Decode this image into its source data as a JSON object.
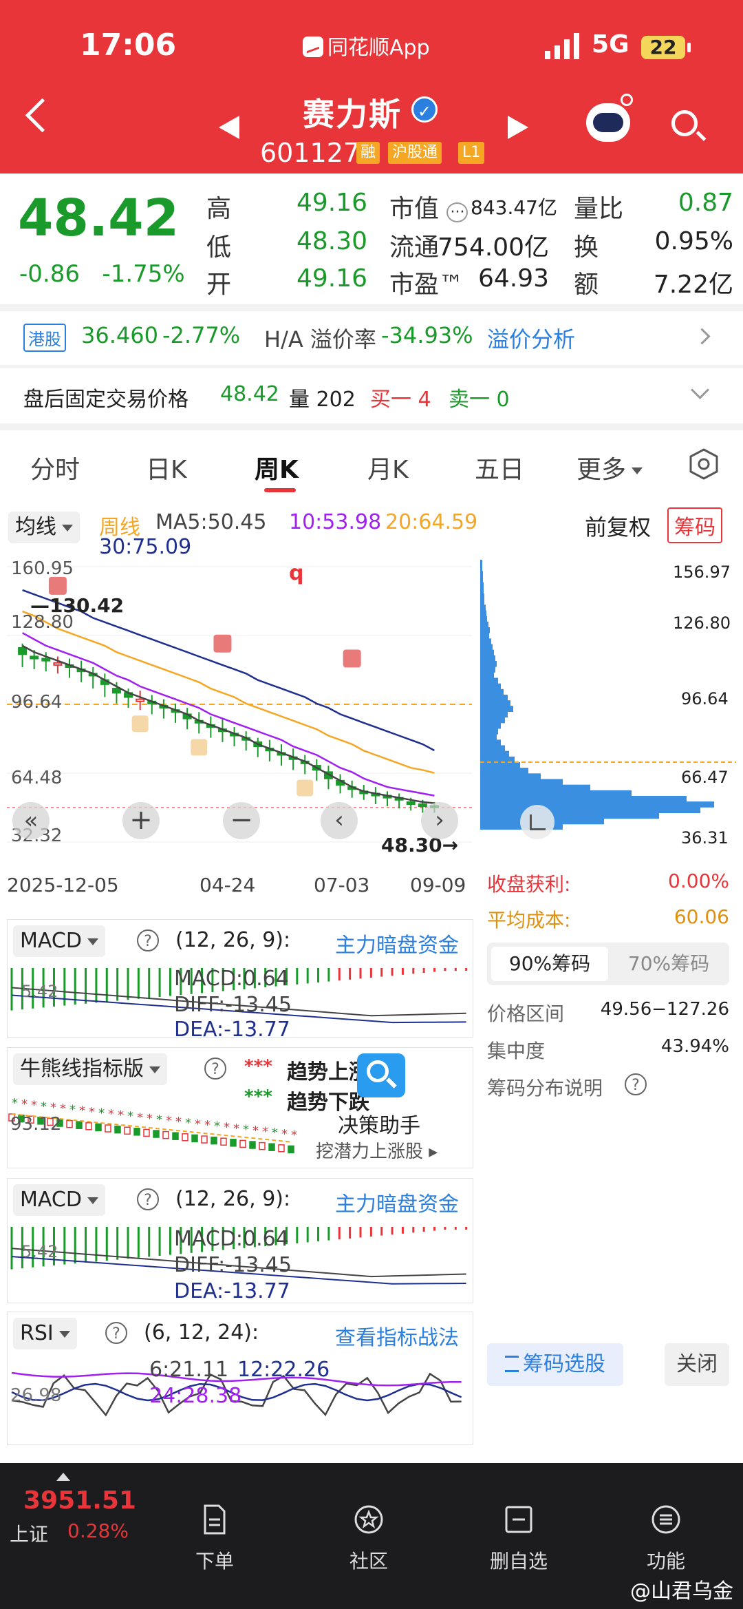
{
  "status": {
    "time": "17:06",
    "app": "同花顺App",
    "network": "5G",
    "battery": "22"
  },
  "header": {
    "name": "赛力斯",
    "code": "601127",
    "tags": [
      "融",
      "沪股通",
      "L1"
    ]
  },
  "quote": {
    "price": "48.42",
    "change": "-0.86",
    "change_pct": "-1.75%",
    "rows": [
      {
        "l1": "高",
        "v1": "49.16",
        "l2": "市值",
        "v2": "843.47亿",
        "l3": "量比",
        "v3": "0.87"
      },
      {
        "l1": "低",
        "v1": "48.30",
        "l2": "流通",
        "v2": "754.00亿",
        "l3": "换",
        "v3": "0.95%"
      },
      {
        "l1": "开",
        "v1": "49.16",
        "l2": "市盈™",
        "v2": "64.93",
        "l3": "额",
        "v3": "7.22亿"
      }
    ]
  },
  "hk": {
    "tag": "港股",
    "price": "36.460",
    "pct": "-2.77%",
    "ha_label": "H/A 溢价率",
    "ha_value": "-34.93%",
    "link": "溢价分析"
  },
  "afterhours": {
    "label": "盘后固定交易价格",
    "price": "48.42",
    "vol_label": "量",
    "vol": "202",
    "buy_label": "买一",
    "buy": "4",
    "sell_label": "卖一",
    "sell": "0"
  },
  "tabs": [
    "分时",
    "日K",
    "周K",
    "月K",
    "五日",
    "更多"
  ],
  "active_tab": "周K",
  "ma": {
    "selector": "均线",
    "period": "周线",
    "ma5": "MA5:50.45",
    "ma10": "10:53.98",
    "ma20": "20:64.59",
    "ma30": "30:75.09",
    "fq": "前复权",
    "chip_btn": "筹码"
  },
  "kchart": {
    "y_labels": [
      "160.95",
      "128.80",
      "96.64",
      "64.48",
      "32.32"
    ],
    "high_label": "130.42",
    "low_label": "48.30",
    "x_labels": [
      "2025-12-05",
      "04-24",
      "07-03",
      "09-09"
    ],
    "marker_q": "q",
    "closes": [
      120,
      118,
      117,
      116,
      114,
      112,
      110,
      106,
      102,
      100,
      99,
      97,
      95,
      93,
      90,
      88,
      86,
      84,
      82,
      80,
      77,
      75,
      73,
      71,
      69,
      66,
      62,
      59,
      57,
      55,
      54,
      53,
      52,
      50,
      49,
      48.4
    ],
    "highs": [
      125,
      122,
      121,
      119,
      118,
      117,
      114,
      111,
      107,
      104,
      103,
      101,
      99,
      97,
      95,
      93,
      91,
      90,
      86,
      84,
      81,
      80,
      78,
      76,
      73,
      71,
      68,
      64,
      61,
      59,
      58,
      56,
      55,
      53,
      52,
      51
    ],
    "lows": [
      114,
      113,
      112,
      111,
      109,
      107,
      104,
      100,
      97,
      95,
      94,
      92,
      90,
      88,
      85,
      83,
      81,
      79,
      77,
      75,
      72,
      70,
      68,
      66,
      64,
      61,
      57,
      55,
      53,
      52,
      50,
      49,
      48,
      47,
      46,
      46
    ],
    "opens": [
      123,
      119,
      118,
      115,
      115,
      113,
      111,
      108,
      104,
      102,
      98,
      98,
      96,
      94,
      92,
      89,
      87,
      85,
      83,
      81,
      79,
      76,
      74,
      72,
      70,
      68,
      65,
      61,
      58,
      56,
      55,
      54,
      53,
      51,
      50,
      49.2
    ],
    "ma5_line": [
      124,
      121,
      119,
      117,
      115,
      113,
      111,
      108,
      105,
      102,
      100,
      98,
      96,
      94,
      92,
      89,
      87,
      85,
      83,
      81,
      78,
      76,
      74,
      72,
      70,
      67,
      64,
      61,
      58,
      56,
      55,
      54,
      53,
      52,
      51,
      50.45
    ],
    "ma10_line": [
      130,
      127,
      124,
      122,
      120,
      118,
      116,
      113,
      110,
      108,
      105,
      103,
      101,
      99,
      97,
      95,
      92,
      90,
      88,
      86,
      84,
      82,
      80,
      77,
      75,
      73,
      70,
      67,
      65,
      62,
      60,
      58,
      57,
      56,
      55,
      53.98
    ],
    "ma20_line": [
      140,
      138,
      135,
      132,
      130,
      128,
      126,
      124,
      121,
      119,
      117,
      115,
      113,
      111,
      109,
      107,
      104,
      102,
      100,
      97,
      95,
      93,
      91,
      89,
      87,
      85,
      82,
      80,
      78,
      75,
      73,
      71,
      69,
      67,
      66,
      64.59
    ],
    "ma30_line": [
      150,
      148,
      146,
      144,
      142,
      140,
      137,
      135,
      133,
      131,
      129,
      127,
      125,
      123,
      121,
      119,
      117,
      115,
      113,
      111,
      108,
      106,
      104,
      102,
      100,
      97,
      95,
      92,
      90,
      88,
      86,
      84,
      82,
      80,
      78,
      75.09
    ]
  },
  "chips": {
    "labels": [
      "156.97",
      "126.80",
      "96.64",
      "66.47",
      "36.31"
    ],
    "profit_label": "收盘获利:",
    "profit": "0.00%",
    "cost_label": "平均成本:",
    "cost": "60.06",
    "tab90": "90%筹码",
    "tab70": "70%筹码",
    "range_label": "价格区间",
    "range": "49.56−127.26",
    "conc_label": "集中度",
    "conc": "43.94%",
    "desc": "筹码分布说明",
    "select_btn": "筹码选股",
    "close_btn": "关闭"
  },
  "macd1": {
    "name": "MACD",
    "params": "(12, 26, 9):",
    "link": "主力暗盘资金",
    "macd": "MACD:0.64",
    "diff": "DIFF:-13.45",
    "dea": "DEA:-13.77",
    "axis": "5.42"
  },
  "bull": {
    "name": "牛熊线指标版",
    "up": "趋势上涨",
    "down": "趋势下跌",
    "axis": "93.12",
    "assistant": "决策助手",
    "assistant_sub": "挖潜力上涨股"
  },
  "macd2": {
    "name": "MACD",
    "params": "(12, 26, 9):",
    "link": "主力暗盘资金",
    "macd": "MACD:0.64",
    "diff": "DIFF:-13.45",
    "dea": "DEA:-13.77",
    "axis": "5.42"
  },
  "rsi": {
    "name": "RSI",
    "params": "(6, 12, 24):",
    "link": "查看指标战法",
    "r6": "6:21.11",
    "r12": "12:22.26",
    "r24": "24:28.38",
    "axis": "26.98"
  },
  "bottom": {
    "index_value": "3951.51",
    "index_name": "上证",
    "index_pct": "0.28%",
    "items": [
      "下单",
      "社区",
      "删自选",
      "功能"
    ]
  },
  "watermark": "@山君乌金",
  "colors": {
    "red": "#e8353a",
    "green": "#1a9a2a",
    "blue": "#2a7fe0",
    "ma10": "#a020f0",
    "ma20": "#f5a623",
    "ma30": "#1f2f8f"
  }
}
